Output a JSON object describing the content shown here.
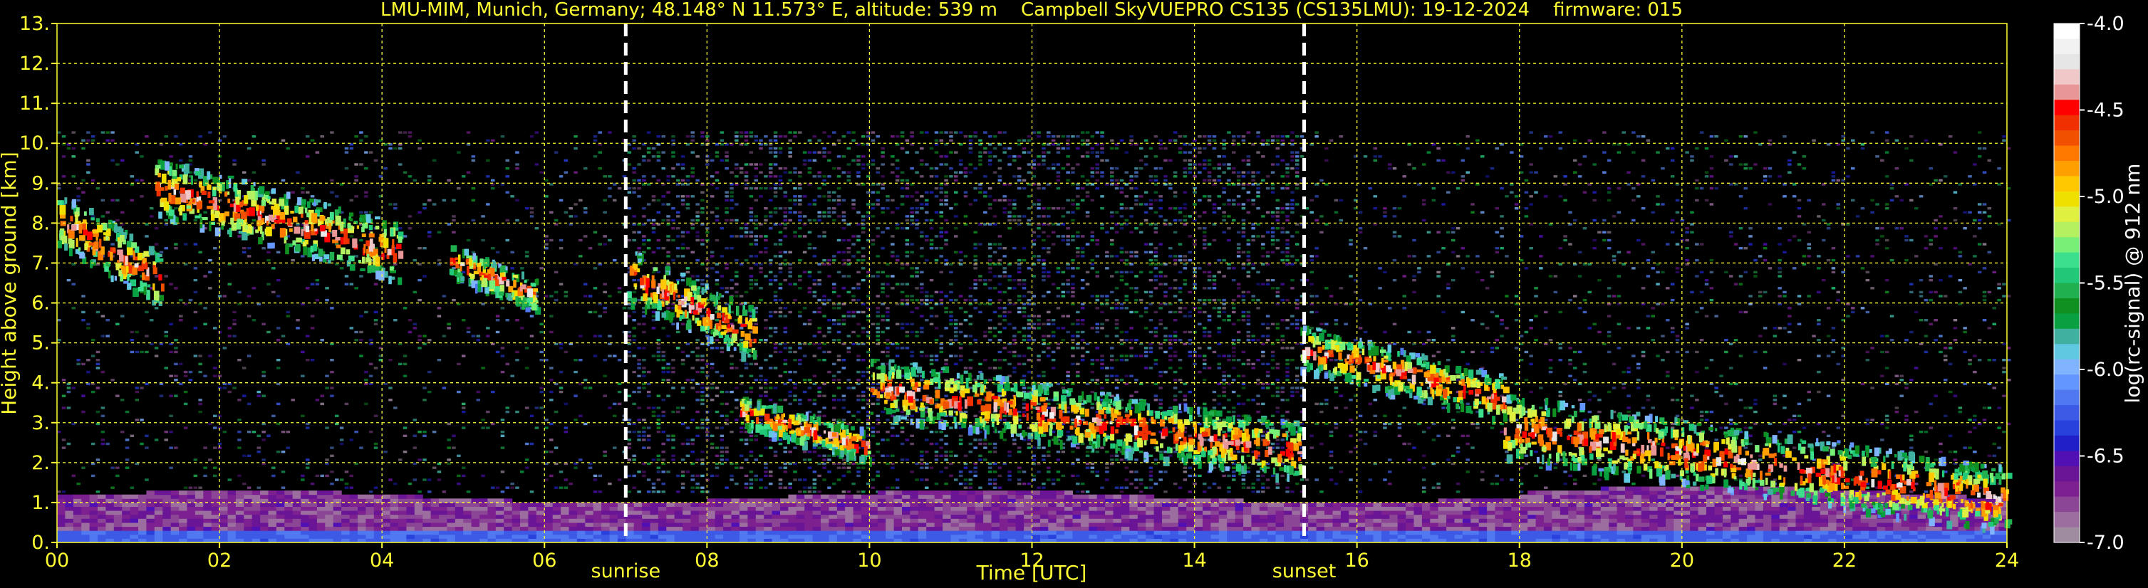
{
  "title": "LMU-MIM, Munich, Germany; 48.148° N 11.573° E, altitude: 539 m    Campbell SkyVUEPRO CS135 (CS135LMU): 19-12-2024    firmware: 015",
  "chart_data": {
    "type": "heatmap",
    "xlabel": "Time [UTC]",
    "ylabel": "Height above ground [km]",
    "xlim": [
      0,
      24
    ],
    "ylim": [
      0,
      13
    ],
    "x_ticks": [
      "00",
      "02",
      "04",
      "06",
      "08",
      "10",
      "12",
      "14",
      "16",
      "18",
      "20",
      "22",
      "24"
    ],
    "y_ticks": [
      "0.",
      "1.",
      "2.",
      "3.",
      "4.",
      "5.",
      "6.",
      "7.",
      "8.",
      "9.",
      "10.",
      "11.",
      "12.",
      "13."
    ],
    "grid": true,
    "annotations": [
      {
        "label": "sunrise",
        "x": 7.0
      },
      {
        "label": "sunset",
        "x": 15.35
      }
    ],
    "colorbar": {
      "label": "log(rc-signal) @ 912 nm",
      "range": [
        -7.0,
        -4.0
      ],
      "ticks": [
        "-4.0",
        "-4.5",
        "-5.0",
        "-5.5",
        "-6.0",
        "-6.5",
        "-7.0"
      ],
      "colors": [
        "#ffffff",
        "#f2f2f2",
        "#e6e6e6",
        "#f0c8c8",
        "#e89696",
        "#ff0000",
        "#f03000",
        "#f05000",
        "#ff7800",
        "#ffa000",
        "#ffc800",
        "#f0e000",
        "#e0f040",
        "#b4f060",
        "#78f078",
        "#3ce08c",
        "#20c878",
        "#20b050",
        "#109020",
        "#08a040",
        "#40b0a0",
        "#60c8e0",
        "#80b4ff",
        "#6496ff",
        "#5078f0",
        "#3c5ae6",
        "#2840dc",
        "#2020c8",
        "#5010b4",
        "#6a1496",
        "#7d2090",
        "#8c4696",
        "#9c6ea0",
        "#a08ca0"
      ]
    },
    "features": [
      {
        "type": "cloud",
        "t_start": 0.0,
        "t_end": 1.3,
        "h_bottom": 5.8,
        "h_top": 9.0
      },
      {
        "type": "cloud",
        "t_start": 1.2,
        "t_end": 4.2,
        "h_bottom": 6.5,
        "h_top": 9.8
      },
      {
        "type": "cloud",
        "t_start": 4.8,
        "t_end": 5.9,
        "h_bottom": 5.8,
        "h_top": 7.6
      },
      {
        "type": "cloud",
        "t_start": 7.0,
        "t_end": 8.6,
        "h_bottom": 4.5,
        "h_top": 7.5
      },
      {
        "type": "cloud",
        "t_start": 8.4,
        "t_end": 10.0,
        "h_bottom": 2.0,
        "h_top": 3.8
      },
      {
        "type": "cloud",
        "t_start": 10.0,
        "t_end": 15.3,
        "h_bottom": 1.5,
        "h_top": 4.8
      },
      {
        "type": "cloud",
        "t_start": 15.3,
        "t_end": 17.8,
        "h_bottom": 3.0,
        "h_top": 5.6
      },
      {
        "type": "cloud",
        "t_start": 17.8,
        "t_end": 24.0,
        "h_bottom": 0.2,
        "h_top": 3.9
      },
      {
        "type": "boundary_layer",
        "t_start": 0.0,
        "t_end": 24.0,
        "h_bottom": 0.0,
        "h_top": 1.2
      }
    ]
  }
}
